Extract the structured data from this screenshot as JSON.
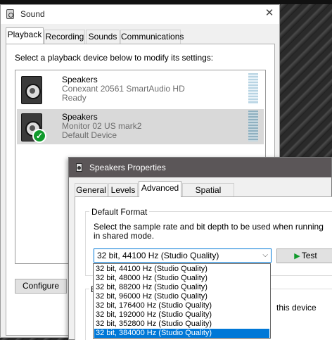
{
  "sound_window": {
    "title": "Sound",
    "close_glyph": "✕",
    "tabs": [
      "Playback",
      "Recording",
      "Sounds",
      "Communications"
    ],
    "active_tab": "Playback",
    "instruction": "Select a playback device below to modify its settings:",
    "devices": [
      {
        "name": "Speakers",
        "description": "Conexant 20561 SmartAudio HD",
        "status": "Ready",
        "icon": "speaker-icon",
        "is_default": false,
        "selected": false
      },
      {
        "name": "Speakers",
        "description": "Monitor 02 US mark2",
        "status": "Default Device",
        "icon": "speaker-icon",
        "is_default": true,
        "selected": true
      }
    ],
    "configure_label": "Configure"
  },
  "props_window": {
    "title": "Speakers Properties",
    "tabs": [
      "General",
      "Levels",
      "Advanced",
      "Spatial sound"
    ],
    "active_tab": "Advanced",
    "default_format_label": "Default Format",
    "format_description": "Select the sample rate and bit depth to be used when running in shared mode.",
    "selected_format": "32 bit, 44100 Hz (Studio Quality)",
    "test_label": "Test",
    "exclusive_group_stub": "E",
    "exclusive_text_stub": "this device",
    "format_options": [
      "32 bit, 44100 Hz (Studio Quality)",
      "32 bit, 48000 Hz (Studio Quality)",
      "32 bit, 88200 Hz (Studio Quality)",
      "32 bit, 96000 Hz (Studio Quality)",
      "32 bit, 176400 Hz (Studio Quality)",
      "32 bit, 192000 Hz (Studio Quality)",
      "32 bit, 352800 Hz (Studio Quality)",
      "32 bit, 384000 Hz (Studio Quality)"
    ],
    "highlighted_option_index": 7
  },
  "colors": {
    "accent": "#0078d7",
    "default_check": "#109a2c",
    "props_titlebar": "#5b5658"
  }
}
